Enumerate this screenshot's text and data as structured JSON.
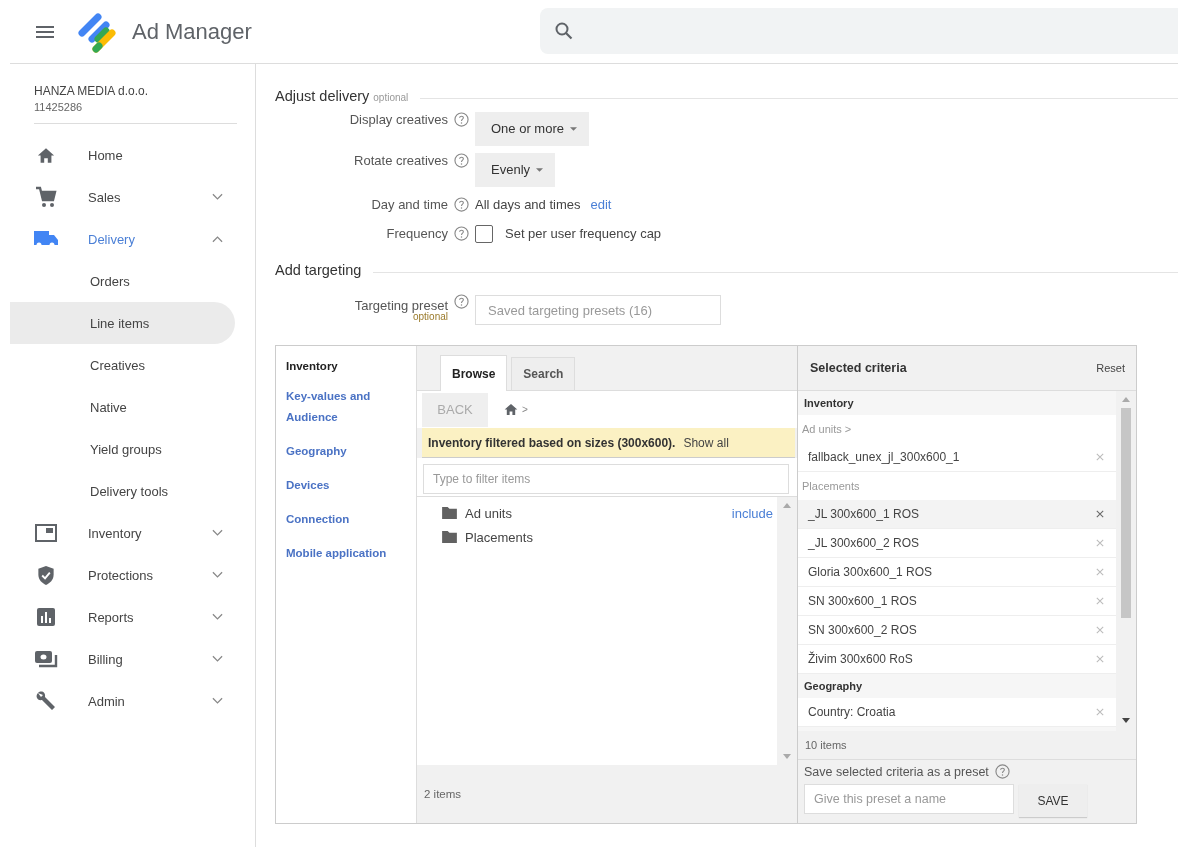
{
  "header": {
    "app_name": "Ad Manager"
  },
  "account": {
    "name": "HANZA MEDIA d.o.o.",
    "id": "11425286"
  },
  "nav": [
    {
      "label": "Home"
    },
    {
      "label": "Sales",
      "expanded": false
    },
    {
      "label": "Delivery",
      "expanded": true,
      "children": [
        {
          "label": "Orders",
          "selected": false
        },
        {
          "label": "Line items",
          "selected": true
        },
        {
          "label": "Creatives",
          "selected": false
        },
        {
          "label": "Native",
          "selected": false
        },
        {
          "label": "Yield groups",
          "selected": false
        },
        {
          "label": "Delivery tools",
          "selected": false
        }
      ]
    },
    {
      "label": "Inventory",
      "expanded": false
    },
    {
      "label": "Protections",
      "expanded": false
    },
    {
      "label": "Reports",
      "expanded": false
    },
    {
      "label": "Billing",
      "expanded": false
    },
    {
      "label": "Admin",
      "expanded": false
    }
  ],
  "adjust_delivery": {
    "title": "Adjust delivery",
    "note": "optional",
    "rows": [
      {
        "kind": "dropdown",
        "label": "Display creatives",
        "value": "One or more"
      },
      {
        "kind": "dropdown",
        "label": "Rotate creatives",
        "value": "Evenly"
      },
      {
        "kind": "text",
        "label": "Day and time",
        "value": "All days and times",
        "link": "edit"
      },
      {
        "kind": "checkbox",
        "label": "Frequency",
        "value": "Set per user frequency cap",
        "checked": false
      }
    ]
  },
  "add_targeting": {
    "title": "Add targeting",
    "preset_label": "Targeting preset",
    "preset_note": "optional",
    "preset_placeholder": "Saved targeting presets (16)"
  },
  "targeting": {
    "categories": [
      {
        "label": "Inventory",
        "selected": true
      },
      {
        "label": "Key-values and Audience",
        "selected": false
      },
      {
        "label": "Geography",
        "selected": false
      },
      {
        "label": "Devices",
        "selected": false
      },
      {
        "label": "Connection",
        "selected": false
      },
      {
        "label": "Mobile application",
        "selected": false
      }
    ],
    "tabs": [
      {
        "label": "Browse",
        "selected": true
      },
      {
        "label": "Search",
        "selected": false
      }
    ],
    "back": "BACK",
    "breadcrumb_sep": ">",
    "banner": {
      "text": "Inventory filtered based on sizes (300x600).",
      "link": "Show all"
    },
    "filter_placeholder": "Type to filter items",
    "items": [
      {
        "label": "Ad units",
        "action": "include"
      },
      {
        "label": "Placements"
      }
    ],
    "items_count": "2 items"
  },
  "selected_criteria": {
    "title": "Selected criteria",
    "reset": "Reset",
    "groups": [
      {
        "heading": "Inventory",
        "sections": [
          {
            "subheading": "Ad units >",
            "items": [
              {
                "label": "fallback_unex_jl_300x600_1",
                "highlighted": false
              }
            ]
          },
          {
            "subheading": "Placements",
            "items": [
              {
                "label": "_JL 300x600_1 ROS",
                "highlighted": true
              },
              {
                "label": "_JL 300x600_2 ROS",
                "highlighted": false
              },
              {
                "label": "Gloria 300x600_1 ROS",
                "highlighted": false
              },
              {
                "label": "SN 300x600_1 ROS",
                "highlighted": false
              },
              {
                "label": "SN 300x600_2 ROS",
                "highlighted": false
              },
              {
                "label": "Živim 300x600 RoS",
                "highlighted": false
              }
            ]
          }
        ]
      },
      {
        "heading": "Geography",
        "sections": [
          {
            "items": [
              {
                "label": "Country: Croatia",
                "highlighted": false
              }
            ]
          }
        ]
      }
    ],
    "count": "10 items",
    "save_label": "Save selected criteria as a preset",
    "save_placeholder": "Give this preset a name",
    "save_button": "SAVE"
  }
}
